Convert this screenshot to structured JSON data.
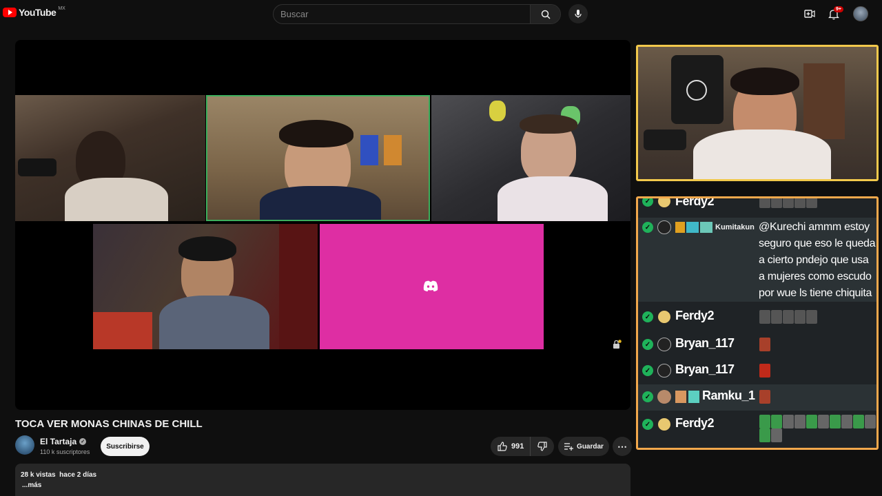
{
  "header": {
    "logo_text": "YouTube",
    "country_code": "MX",
    "search_placeholder": "Buscar",
    "notifications_badge": "9+"
  },
  "video": {
    "title": "TOCA VER MONAS CHINAS DE CHILL",
    "channel": {
      "name": "El Tartaja",
      "subscribers": "110 k suscriptores",
      "subscribe_label": "Suscribirse"
    },
    "likes": "991",
    "save_label": "Guardar",
    "views": "28 k vistas",
    "date": "hace 2 días",
    "more_label": "...más"
  },
  "chat": {
    "messages": [
      {
        "user": "Ferdy2",
        "text": ""
      },
      {
        "user": "Kumitakun",
        "text": "@Kurechi ammm estoy seguro que eso le queda a cierto pndejo que usa a mujeres como escudo por wue ls tiene chiquita"
      },
      {
        "user": "Ferdy2",
        "text": ""
      },
      {
        "user": "Bryan_117",
        "text": ""
      },
      {
        "user": "Bryan_117",
        "text": ""
      },
      {
        "user": "Ramku_1",
        "text": ""
      },
      {
        "user": "Ferdy2",
        "text": ""
      }
    ]
  },
  "colors": {
    "brand_red": "#ff0000",
    "cam_border_cam": "#f2c94c",
    "cam_border_chat": "#f2a84c",
    "discord_pink": "#de2ea3",
    "chat_check": "#1fb25a"
  },
  "icons": [
    "youtube-logo-icon",
    "search-icon",
    "mic-icon",
    "create-icon",
    "bell-icon",
    "discord-icon",
    "like-icon",
    "dislike-icon",
    "save-icon",
    "more-icon",
    "verified-icon"
  ]
}
